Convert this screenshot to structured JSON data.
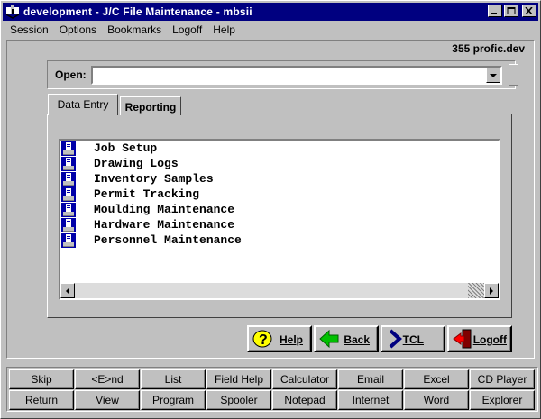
{
  "window": {
    "title": "development - J/C File Maintenance - mbsii"
  },
  "menu": [
    "Session",
    "Options",
    "Bookmarks",
    "Logoff",
    "Help"
  ],
  "host": "355 profic.dev",
  "open": {
    "label": "Open:",
    "value": ""
  },
  "tabs": [
    {
      "label": "Data Entry",
      "active": true
    },
    {
      "label": "Reporting",
      "active": false
    }
  ],
  "list_items": [
    {
      "label": "Job Setup",
      "icon": "document-program-icon"
    },
    {
      "label": "Drawing Logs",
      "icon": "document-program-icon"
    },
    {
      "label": "Inventory Samples",
      "icon": "document-program-icon"
    },
    {
      "label": "Permit Tracking",
      "icon": "document-program-icon"
    },
    {
      "label": "Moulding Maintenance",
      "icon": "document-program-icon"
    },
    {
      "label": "Hardware Maintenance",
      "icon": "document-program-icon"
    },
    {
      "label": "Personnel Maintenance",
      "icon": "document-program-icon"
    }
  ],
  "actions": {
    "help": "Help",
    "back": "Back",
    "tcl": "TCL",
    "logoff": "Logoff"
  },
  "fkeys": {
    "row1": [
      "Skip",
      "<E>nd",
      "List",
      "Field Help",
      "Calculator",
      "Email",
      "Excel",
      "CD Player"
    ],
    "row2": [
      "Return",
      "View",
      "Program",
      "Spooler",
      "Notepad",
      "Internet",
      "Word",
      "Explorer"
    ]
  },
  "colors": {
    "titlebar": "#000080",
    "face": "#c0c0c0"
  }
}
